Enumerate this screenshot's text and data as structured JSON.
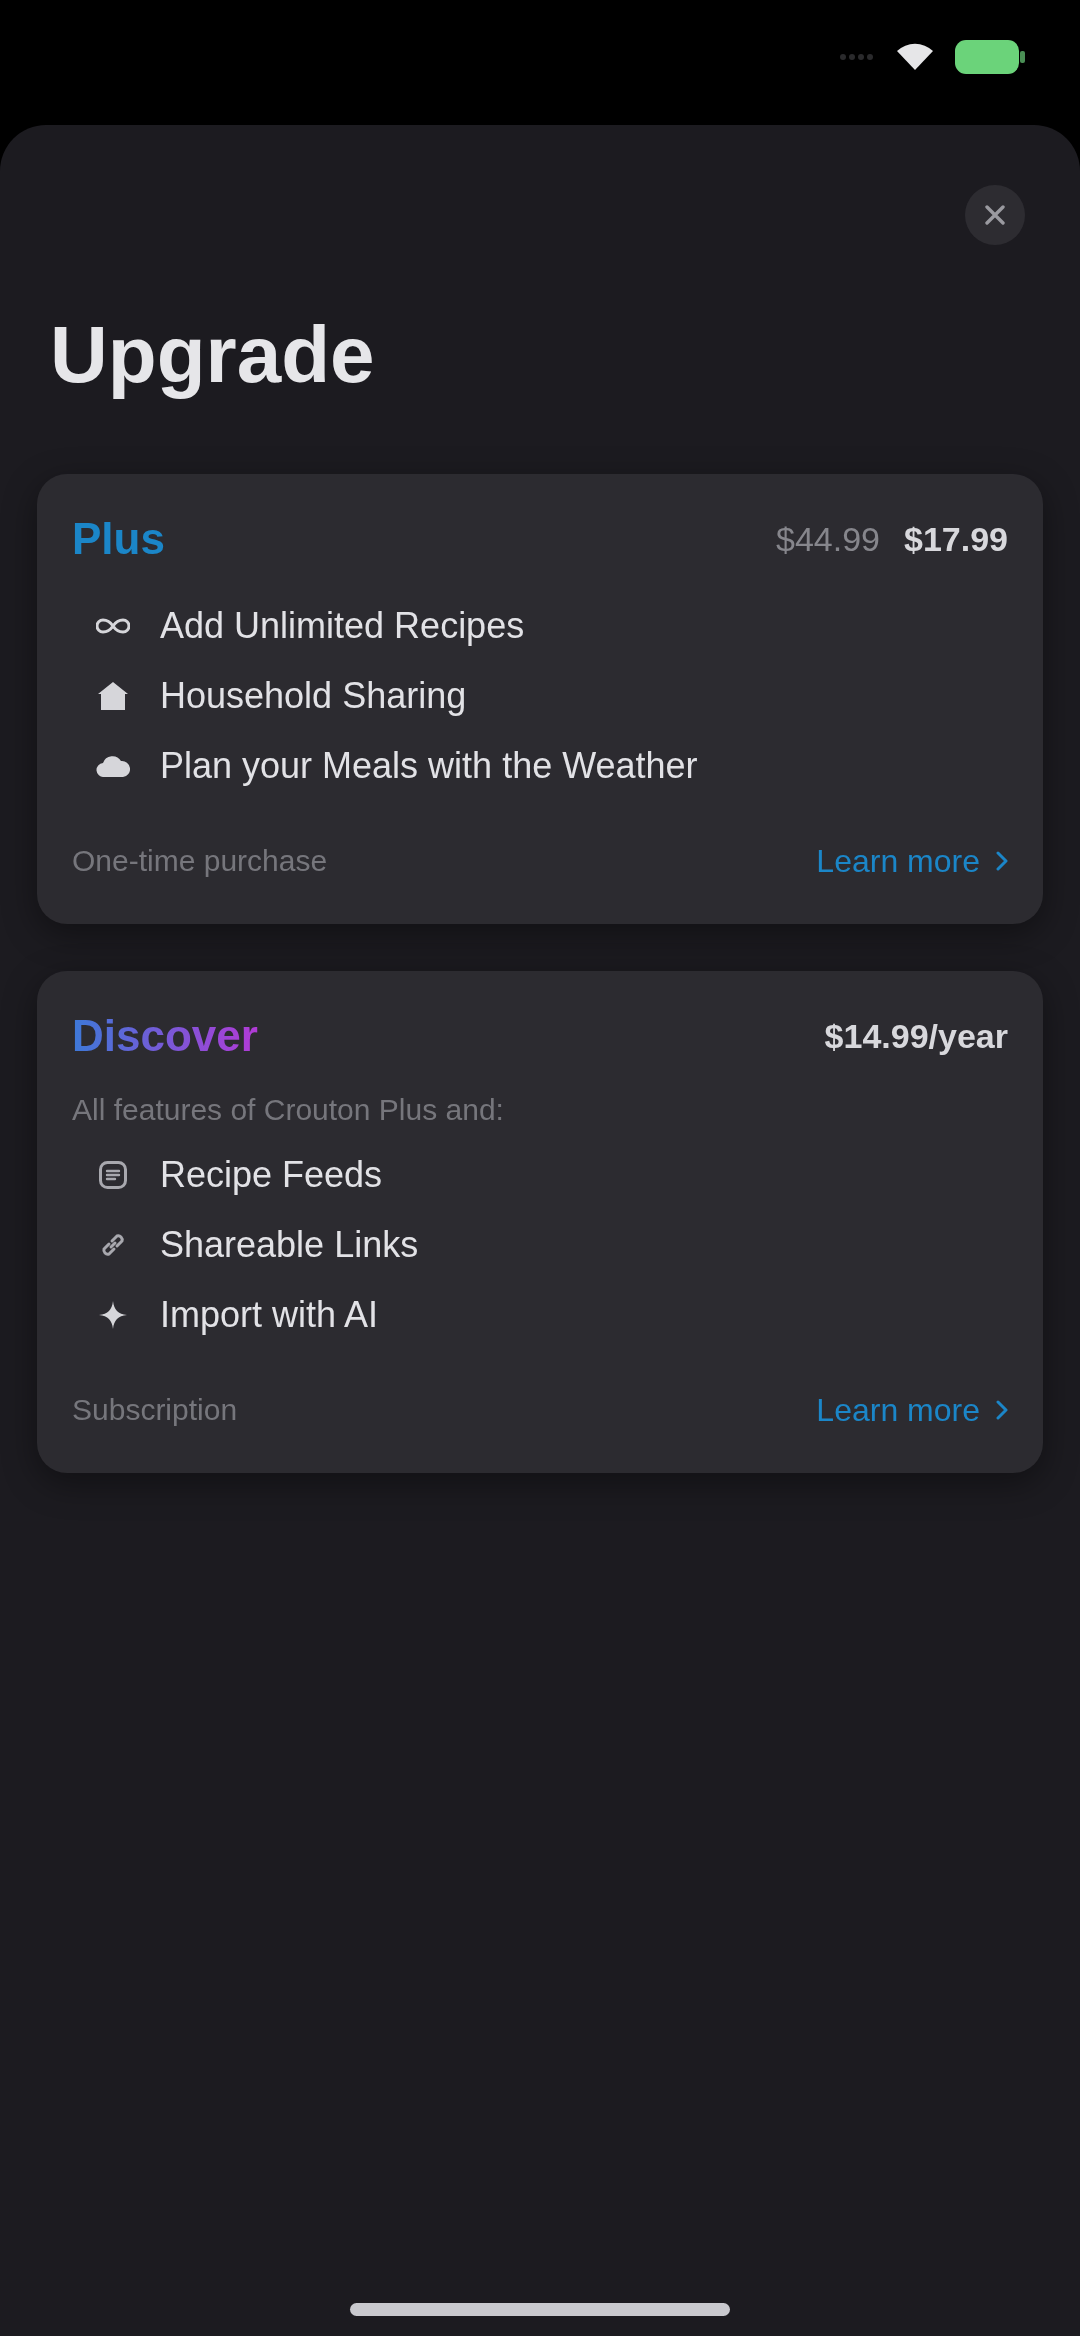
{
  "title": "Upgrade",
  "plans": [
    {
      "name": "Plus",
      "kind": "solid",
      "prices": [
        {
          "text": "$44.99",
          "kind": "former"
        },
        {
          "text": "$17.99",
          "kind": "current"
        }
      ],
      "features": [
        "Add Unlimited Recipes",
        "Household Sharing",
        "Plan your Meals with the Weather"
      ],
      "footnote": "One-time purchase",
      "link": "Learn more"
    },
    {
      "name": "Discover",
      "kind": "gradient",
      "prices": [
        {
          "text": "$14.99/year",
          "kind": "current"
        }
      ],
      "subtitle": "All features of Crouton Plus and:",
      "features": [
        "Recipe Feeds",
        "Shareable Links",
        "Import with AI"
      ],
      "footnote": "Subscription",
      "link": "Learn more"
    }
  ]
}
